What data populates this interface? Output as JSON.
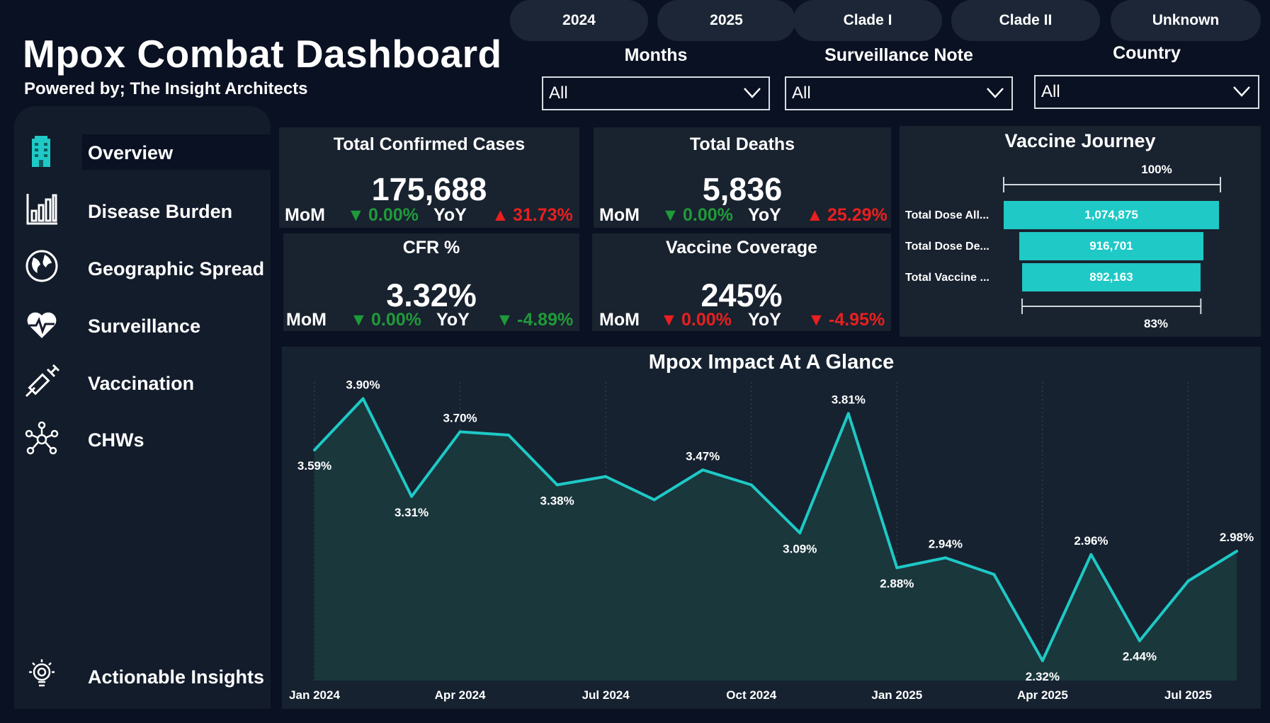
{
  "header": {
    "title": "Mpox Combat Dashboard",
    "subtitle": "Powered by; The Insight Architects"
  },
  "slicers": {
    "pills": [
      "2024",
      "2025",
      "Clade I",
      "Clade II",
      "Unknown"
    ],
    "filters": [
      {
        "label": "Months",
        "value": "All"
      },
      {
        "label": "Surveillance Note",
        "value": "All"
      },
      {
        "label": "Country",
        "value": "All"
      }
    ]
  },
  "sidebar": {
    "items": [
      {
        "label": "Overview",
        "icon": "building-icon",
        "active": true
      },
      {
        "label": "Disease Burden",
        "icon": "bar-chart-icon"
      },
      {
        "label": "Geographic Spread",
        "icon": "globe-icon"
      },
      {
        "label": "Surveillance",
        "icon": "heartbeat-icon"
      },
      {
        "label": "Vaccination",
        "icon": "syringe-icon"
      },
      {
        "label": "CHWs",
        "icon": "network-icon"
      },
      {
        "label": "Actionable Insights",
        "icon": "lightbulb-icon"
      }
    ]
  },
  "kpis": {
    "mom_label": "MoM",
    "yoy_label": "YoY",
    "cards": [
      {
        "title": "Total Confirmed Cases",
        "value": "175,688",
        "mom": "0.00%",
        "mom_dir": "down",
        "mom_color": "#1f9a3a",
        "yoy": "31.73%",
        "yoy_dir": "up",
        "yoy_color": "#e8201f"
      },
      {
        "title": "Total Deaths",
        "value": "5,836",
        "mom": "0.00%",
        "mom_dir": "down",
        "mom_color": "#1f9a3a",
        "yoy": "25.29%",
        "yoy_dir": "up",
        "yoy_color": "#e8201f"
      },
      {
        "title": "CFR %",
        "value": "3.32%",
        "mom": "0.00%",
        "mom_dir": "down",
        "mom_color": "#1f9a3a",
        "yoy": "-4.89%",
        "yoy_dir": "down",
        "yoy_color": "#1f9a3a"
      },
      {
        "title": "Vaccine Coverage",
        "value": "245%",
        "mom": "0.00%",
        "mom_dir": "down",
        "mom_color": "#e8201f",
        "yoy": "-4.95%",
        "yoy_dir": "down",
        "yoy_color": "#e8201f"
      }
    ]
  },
  "vaccine_journey": {
    "title": "Vaccine Journey",
    "top_pct": "100%",
    "bottom_pct": "83%",
    "bars": [
      {
        "label": "Total Dose All...",
        "value": 1074875,
        "display": "1,074,875"
      },
      {
        "label": "Total Dose De...",
        "value": 916701,
        "display": "916,701"
      },
      {
        "label": "Total Vaccine ...",
        "value": 892163,
        "display": "892,163"
      }
    ],
    "bar_color": "#1ec9c6"
  },
  "chart_data": {
    "type": "area",
    "title": "Mpox Impact At A Glance",
    "x_ticks": [
      "Jan 2024",
      "Apr 2024",
      "Jul 2024",
      "Oct 2024",
      "Jan 2025",
      "Apr 2025",
      "Jul 2025"
    ],
    "x": [
      "Jan 2024",
      "Feb 2024",
      "Mar 2024",
      "Apr 2024",
      "May 2024",
      "Jun 2024",
      "Jul 2024",
      "Aug 2024",
      "Sep 2024",
      "Oct 2024",
      "Nov 2024",
      "Dec 2024",
      "Jan 2025",
      "Feb 2025",
      "Mar 2025",
      "Apr 2025",
      "May 2025",
      "Jun 2025",
      "Jul 2025",
      "Aug 2025"
    ],
    "values": [
      3.59,
      3.9,
      3.31,
      3.7,
      3.68,
      3.38,
      3.43,
      3.29,
      3.47,
      3.38,
      3.09,
      3.81,
      2.88,
      2.94,
      2.84,
      2.32,
      2.96,
      2.44,
      2.8,
      2.98
    ],
    "labels": [
      "3.59%",
      "3.90%",
      "3.31%",
      "3.70%",
      "",
      "3.38%",
      "",
      "",
      "3.47%",
      "",
      "3.09%",
      "3.81%",
      "2.88%",
      "2.94%",
      "",
      "2.32%",
      "2.96%",
      "2.44%",
      "",
      "2.98%"
    ],
    "label_pos": [
      "below",
      "above",
      "below",
      "above",
      "",
      "below",
      "",
      "",
      "above",
      "",
      "below",
      "above",
      "below",
      "above",
      "",
      "below",
      "above",
      "below",
      "",
      "above"
    ],
    "ylim": [
      2.2,
      4.0
    ],
    "line_color": "#1ec9c6",
    "fill_color": "#1b3a3e"
  }
}
